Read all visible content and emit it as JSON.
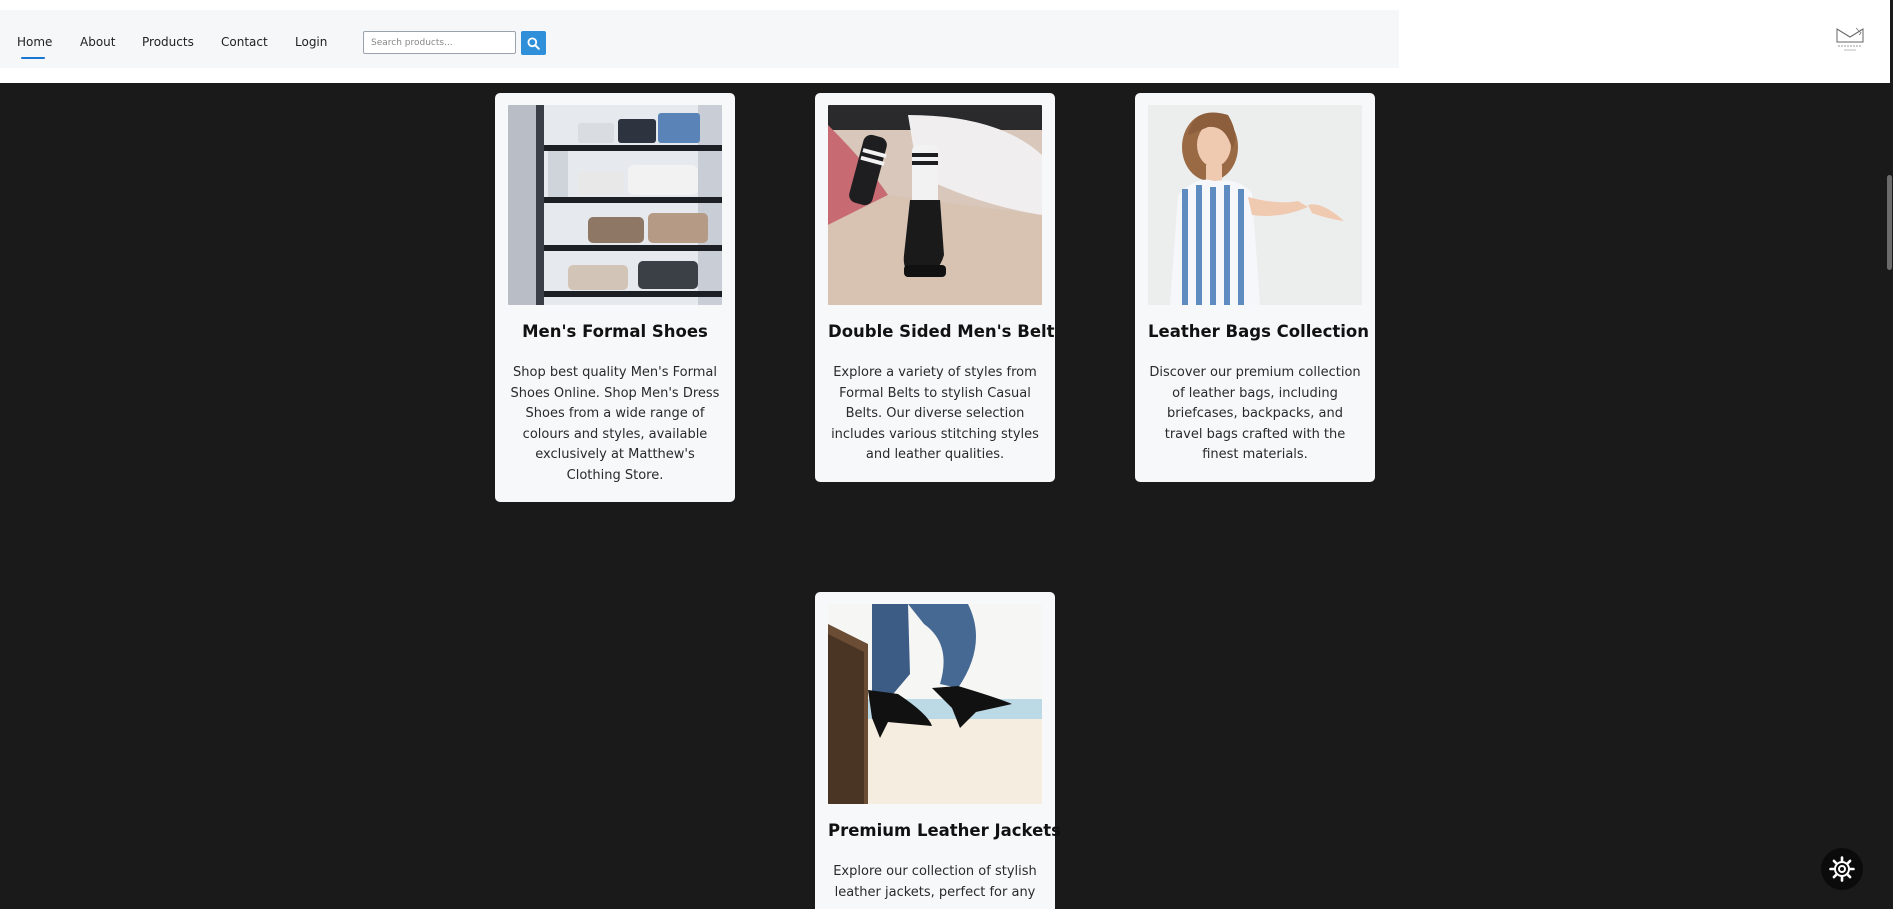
{
  "nav": {
    "items": [
      {
        "label": "Home",
        "active": true
      },
      {
        "label": "About"
      },
      {
        "label": "Products"
      },
      {
        "label": "Contact"
      },
      {
        "label": "Login"
      }
    ],
    "search_placeholder": "Search products...",
    "search_icon": "search-icon",
    "accent_color": "#1976d2",
    "search_button_color": "#2f8fd8"
  },
  "logo": {
    "icon": "store-logo"
  },
  "products": [
    {
      "title": "Men's Formal Shoes",
      "description": "Shop best quality Men's Formal Shoes Online. Shop Men's Dress Shoes from a wide range of colours and styles, available exclusively at Matthew's Clothing Store.",
      "image": "clothing-shelves-photo"
    },
    {
      "title": "Double Sided Men's Belt",
      "description": "Explore a variety of styles from Formal Belts to stylish Casual Belts. Our diverse selection includes various stitching styles and leather qualities.",
      "image": "boots-and-socks-photo"
    },
    {
      "title": "Leather Bags Collection",
      "description": "Discover our premium collection of leather bags, including briefcases, backpacks, and travel bags crafted with the finest materials.",
      "image": "woman-striped-dress-photo"
    },
    {
      "title": "Premium Leather Jackets",
      "description": "Explore our collection of stylish leather jackets, perfect for any",
      "image": "black-heels-photo"
    }
  ],
  "theme": {
    "page_background": "#1a1a1a",
    "card_background": "#f7f8fa"
  },
  "settings_icon": "gear-icon"
}
